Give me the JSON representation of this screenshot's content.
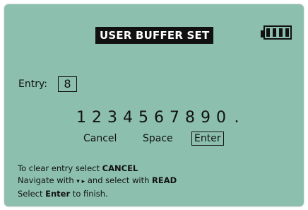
{
  "screen": {
    "title": "USER BUFFER SET",
    "background": "#8cbfae",
    "battery": {
      "icon": "battery-icon",
      "level": 1.0,
      "cells": 4
    }
  },
  "entry": {
    "label": "Entry:",
    "value": "8"
  },
  "keypad": {
    "digits": [
      "1",
      "2",
      "3",
      "4",
      "5",
      "6",
      "7",
      "8",
      "9",
      "0",
      "."
    ],
    "options": {
      "cancel": "Cancel",
      "space": "Space",
      "enter": "Enter"
    },
    "selected": "Enter"
  },
  "help": {
    "line1_prefix": "To clear entry select ",
    "line1_keyword": "CANCEL",
    "line2_prefix": "Navigate with ",
    "line2_arrows": "▾ ▸",
    "line2_middle": " and select with ",
    "line2_keyword": "READ",
    "line3_prefix": "Select ",
    "line3_keyword": "Enter",
    "line3_suffix": " to finish."
  }
}
